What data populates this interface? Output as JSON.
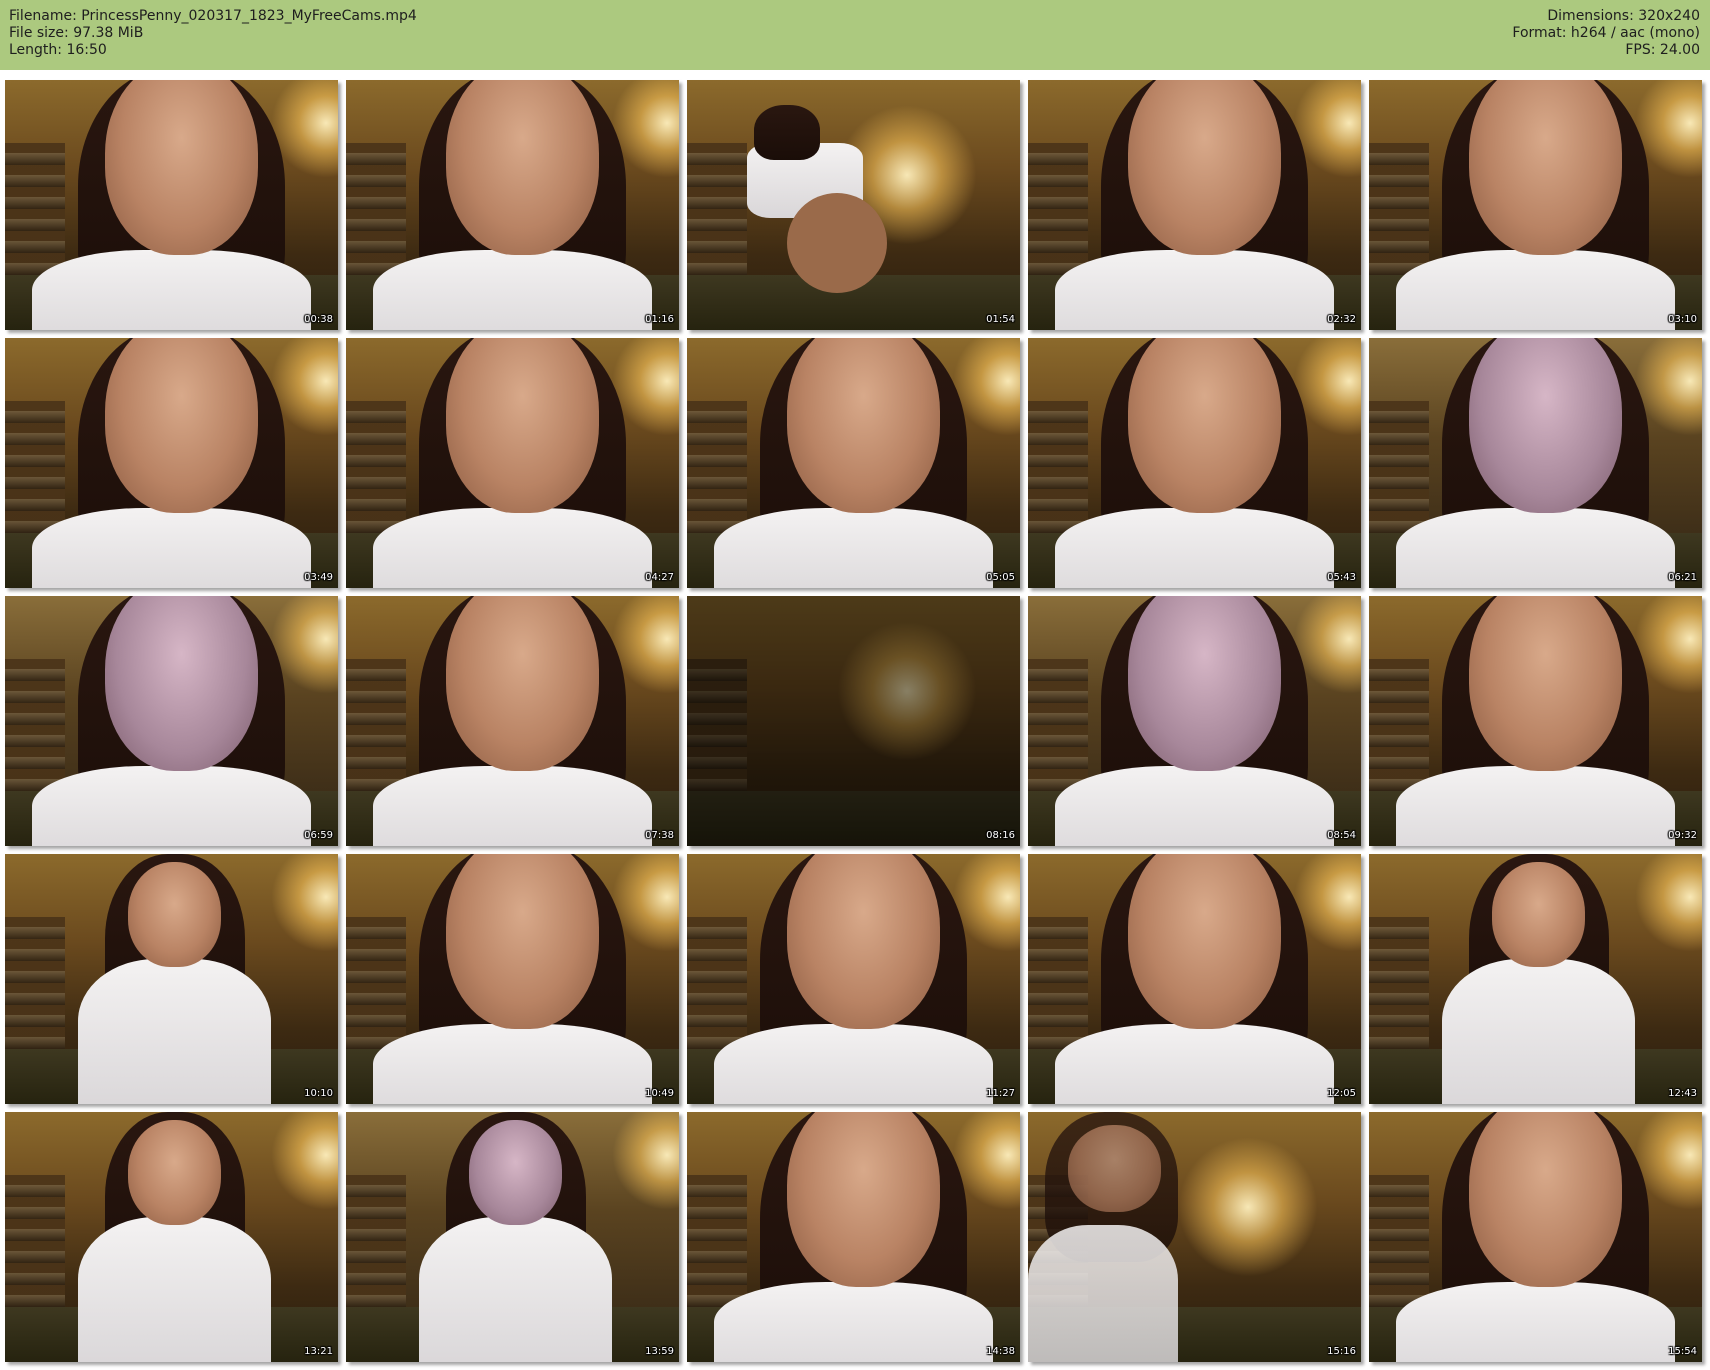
{
  "header": {
    "left_lines": [
      "Filename: PrincessPenny_020317_1823_MyFreeCams.mp4",
      "File size: 97.38 MiB",
      "Length: 16:50"
    ],
    "right_lines": [
      "Dimensions: 320x240",
      "Format: h264 / aac (mono)",
      "FPS: 24.00"
    ]
  },
  "colors": {
    "header_background": "#acc97f",
    "page_background": "#ffffff"
  },
  "thumbnails": [
    {
      "timestamp": "00:38"
    },
    {
      "timestamp": "01:16"
    },
    {
      "timestamp": "01:54"
    },
    {
      "timestamp": "02:32"
    },
    {
      "timestamp": "03:10"
    },
    {
      "timestamp": "03:49"
    },
    {
      "timestamp": "04:27"
    },
    {
      "timestamp": "05:05"
    },
    {
      "timestamp": "05:43"
    },
    {
      "timestamp": "06:21"
    },
    {
      "timestamp": "06:59"
    },
    {
      "timestamp": "07:38"
    },
    {
      "timestamp": "08:16"
    },
    {
      "timestamp": "08:54"
    },
    {
      "timestamp": "09:32"
    },
    {
      "timestamp": "10:10"
    },
    {
      "timestamp": "10:49"
    },
    {
      "timestamp": "11:27"
    },
    {
      "timestamp": "12:05"
    },
    {
      "timestamp": "12:43"
    },
    {
      "timestamp": "13:21"
    },
    {
      "timestamp": "13:59"
    },
    {
      "timestamp": "14:38"
    },
    {
      "timestamp": "15:16"
    },
    {
      "timestamp": "15:54"
    }
  ]
}
